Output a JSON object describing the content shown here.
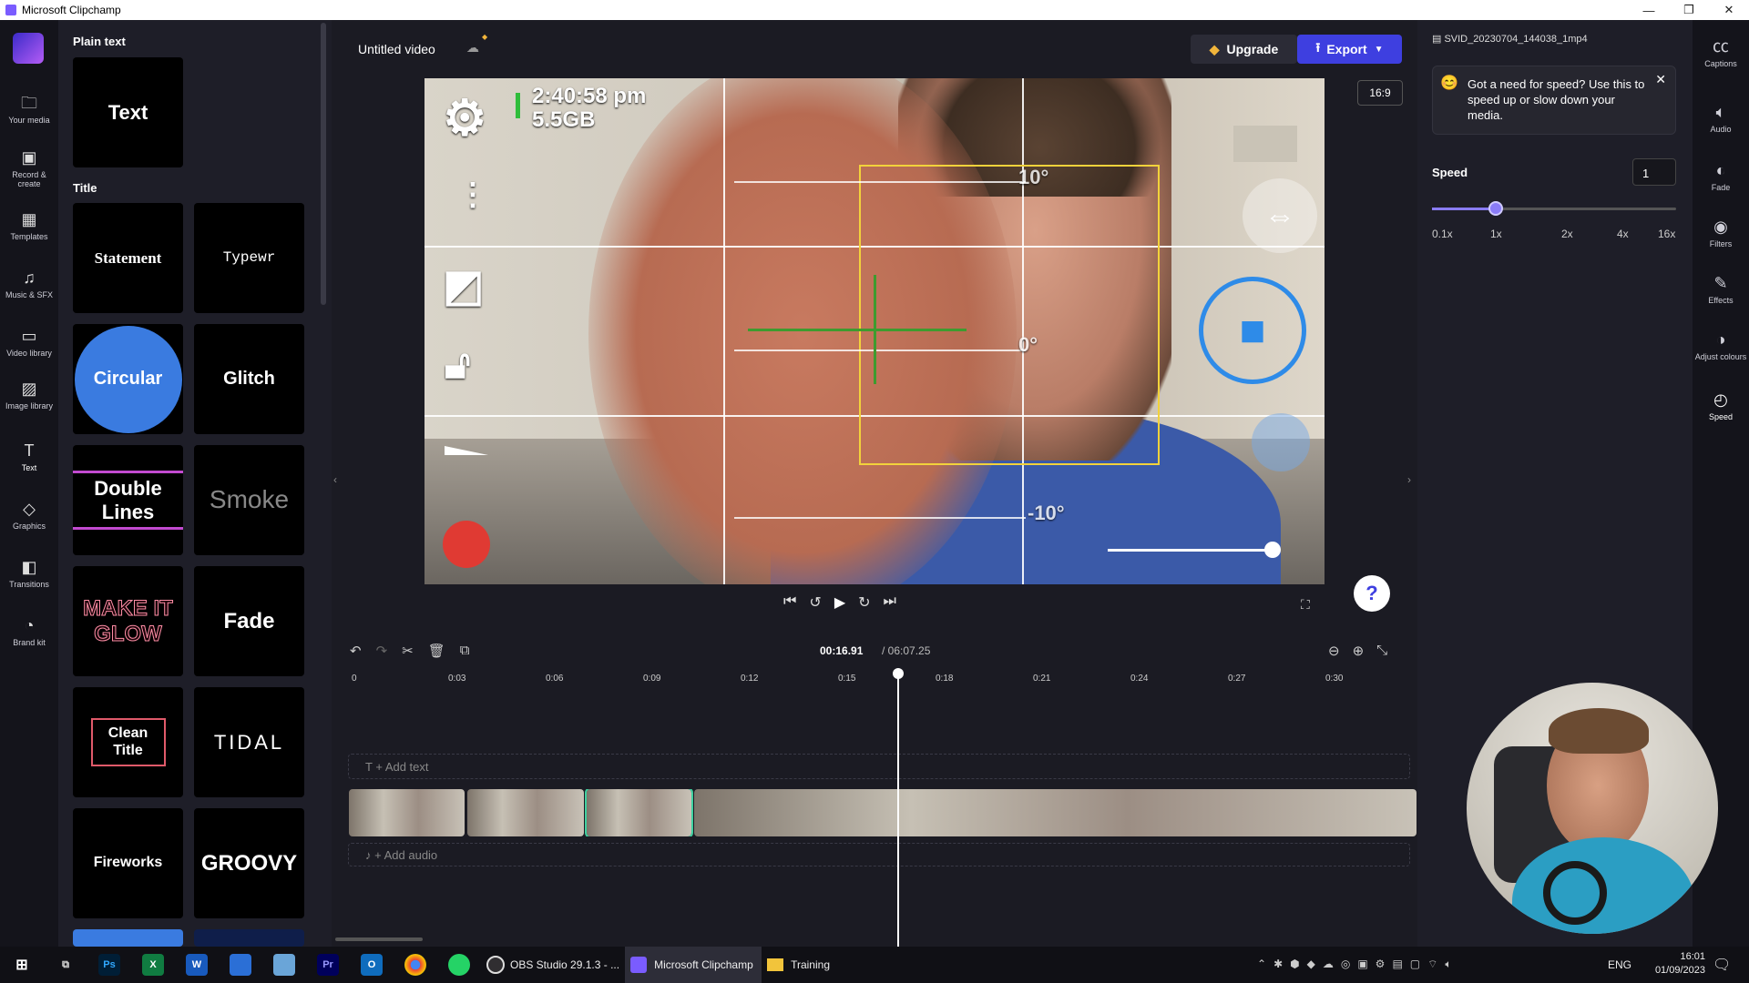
{
  "window": {
    "title": "Microsoft Clipchamp",
    "controls": [
      "—",
      "❐",
      "✕"
    ]
  },
  "leftnav": [
    {
      "label": "Your media",
      "icon": "folder-icon"
    },
    {
      "label": "Record & create",
      "icon": "camera-icon"
    },
    {
      "label": "Templates",
      "icon": "templates-icon"
    },
    {
      "label": "Music & SFX",
      "icon": "music-icon"
    },
    {
      "label": "Video library",
      "icon": "video-library-icon"
    },
    {
      "label": "Image library",
      "icon": "image-icon"
    },
    {
      "label": "Text",
      "icon": "text-icon"
    },
    {
      "label": "Graphics",
      "icon": "graphics-icon"
    },
    {
      "label": "Transitions",
      "icon": "transitions-icon"
    },
    {
      "label": "Brand kit",
      "icon": "brand-kit-icon"
    }
  ],
  "panel": {
    "plain_text_heading": "Plain text",
    "text_card": "Text",
    "title_heading": "Title",
    "cards": [
      "Statement",
      "Typewr",
      "Circular",
      "Glitch",
      "Double Lines",
      "Smoke",
      "MAKE IT GLOW",
      "Fade",
      "Clean Title",
      "TIDAL",
      "Fireworks",
      "GROOVY"
    ]
  },
  "topbar": {
    "project_name": "Untitled video",
    "upgrade": "Upgrade",
    "export": "Export",
    "aspect": "16:9"
  },
  "preview": {
    "time_overlay": "2:40:58 pm",
    "storage_overlay": "5.5GB",
    "angle_top": "10°",
    "angle_mid": "0°",
    "angle_bottom": "-10°"
  },
  "player": {
    "current": "00:16.91",
    "total": "/ 06:07.25"
  },
  "timeline": {
    "ticks": [
      "0",
      "0:03",
      "0:06",
      "0:09",
      "0:12",
      "0:15",
      "0:18",
      "0:21",
      "0:24",
      "0:27",
      "0:30"
    ],
    "add_text": "+ Add text",
    "add_audio": "+ Add audio"
  },
  "rightpanel": {
    "filename": "SVID_20230704_144038_1mp4",
    "tip": "Got a need for speed? Use this to speed up or slow down your media.",
    "speed_label": "Speed",
    "speed_value": "1",
    "speed_level": "1x",
    "speed_ticks": [
      "0.1x",
      "1x",
      "2x",
      "4x",
      "16x"
    ]
  },
  "rightnav": [
    {
      "label": "Captions",
      "icon": "captions-icon"
    },
    {
      "label": "Audio",
      "icon": "audio-icon"
    },
    {
      "label": "Fade",
      "icon": "fade-icon"
    },
    {
      "label": "Filters",
      "icon": "filters-icon"
    },
    {
      "label": "Effects",
      "icon": "effects-icon"
    },
    {
      "label": "Adjust colours",
      "icon": "adjust-colours-icon"
    },
    {
      "label": "Speed",
      "icon": "speed-icon"
    }
  ],
  "taskbar": {
    "obs": "OBS Studio 29.1.3 - ...",
    "clipchamp": "Microsoft Clipchamp",
    "training": "Training",
    "lang": "ENG",
    "time": "16:01",
    "date": "01/09/2023"
  }
}
